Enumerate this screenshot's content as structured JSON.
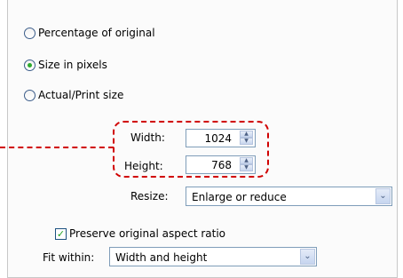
{
  "options": {
    "percentage": {
      "label": "Percentage of original",
      "checked": false
    },
    "pixels": {
      "label": "Size in pixels",
      "checked": true
    },
    "actual": {
      "label": "Actual/Print size",
      "checked": false
    }
  },
  "width": {
    "label": "Width:",
    "value": "1024"
  },
  "height": {
    "label": "Height:",
    "value": "768"
  },
  "resize": {
    "label": "Resize:",
    "value": "Enlarge or reduce"
  },
  "preserve": {
    "label": "Preserve original aspect ratio",
    "checked": true
  },
  "fit": {
    "label": "Fit within:",
    "value": "Width and height"
  },
  "colors": {
    "highlight": "#d00000",
    "radio_dot": "#2eaa2e",
    "field_border": "#7f9db9"
  }
}
